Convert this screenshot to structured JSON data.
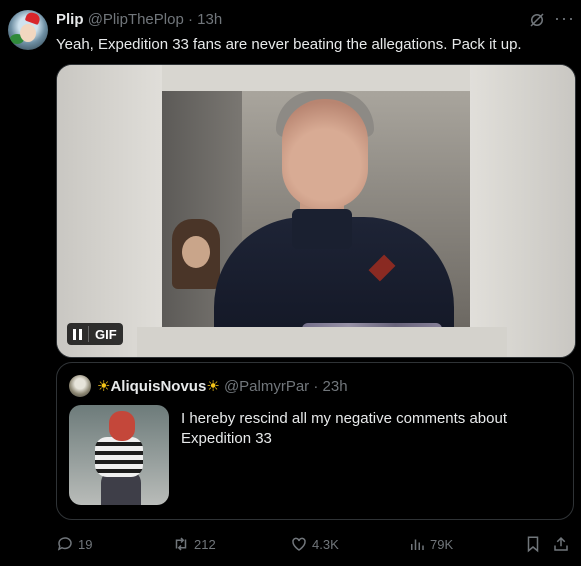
{
  "post": {
    "author_name": "Plip",
    "author_handle": "@PlipThePlop",
    "separator": "·",
    "time": "13h",
    "text": "Yeah, Expedition 33 fans are never beating the allegations. Pack it up.",
    "more_icon": "more-icon",
    "grok_icon": "grok-icon",
    "media": {
      "badge_label": "GIF",
      "badge_icon": "pause-icon"
    }
  },
  "quote": {
    "sun_left": "☀",
    "author_name": "AliquisNovus",
    "sun_right": "☀",
    "author_handle": "@PalmyrPar",
    "separator": "·",
    "time": "23h",
    "text": "I hereby rescind all my negative comments about Expedition 33"
  },
  "actions": {
    "replies": "19",
    "reposts": "212",
    "likes": "4.3K",
    "views": "79K"
  },
  "colors": {
    "background": "#000000",
    "text_primary": "#e7e9ea",
    "text_secondary": "#71767b",
    "border": "#2f3336",
    "sun": "#f5c518"
  }
}
